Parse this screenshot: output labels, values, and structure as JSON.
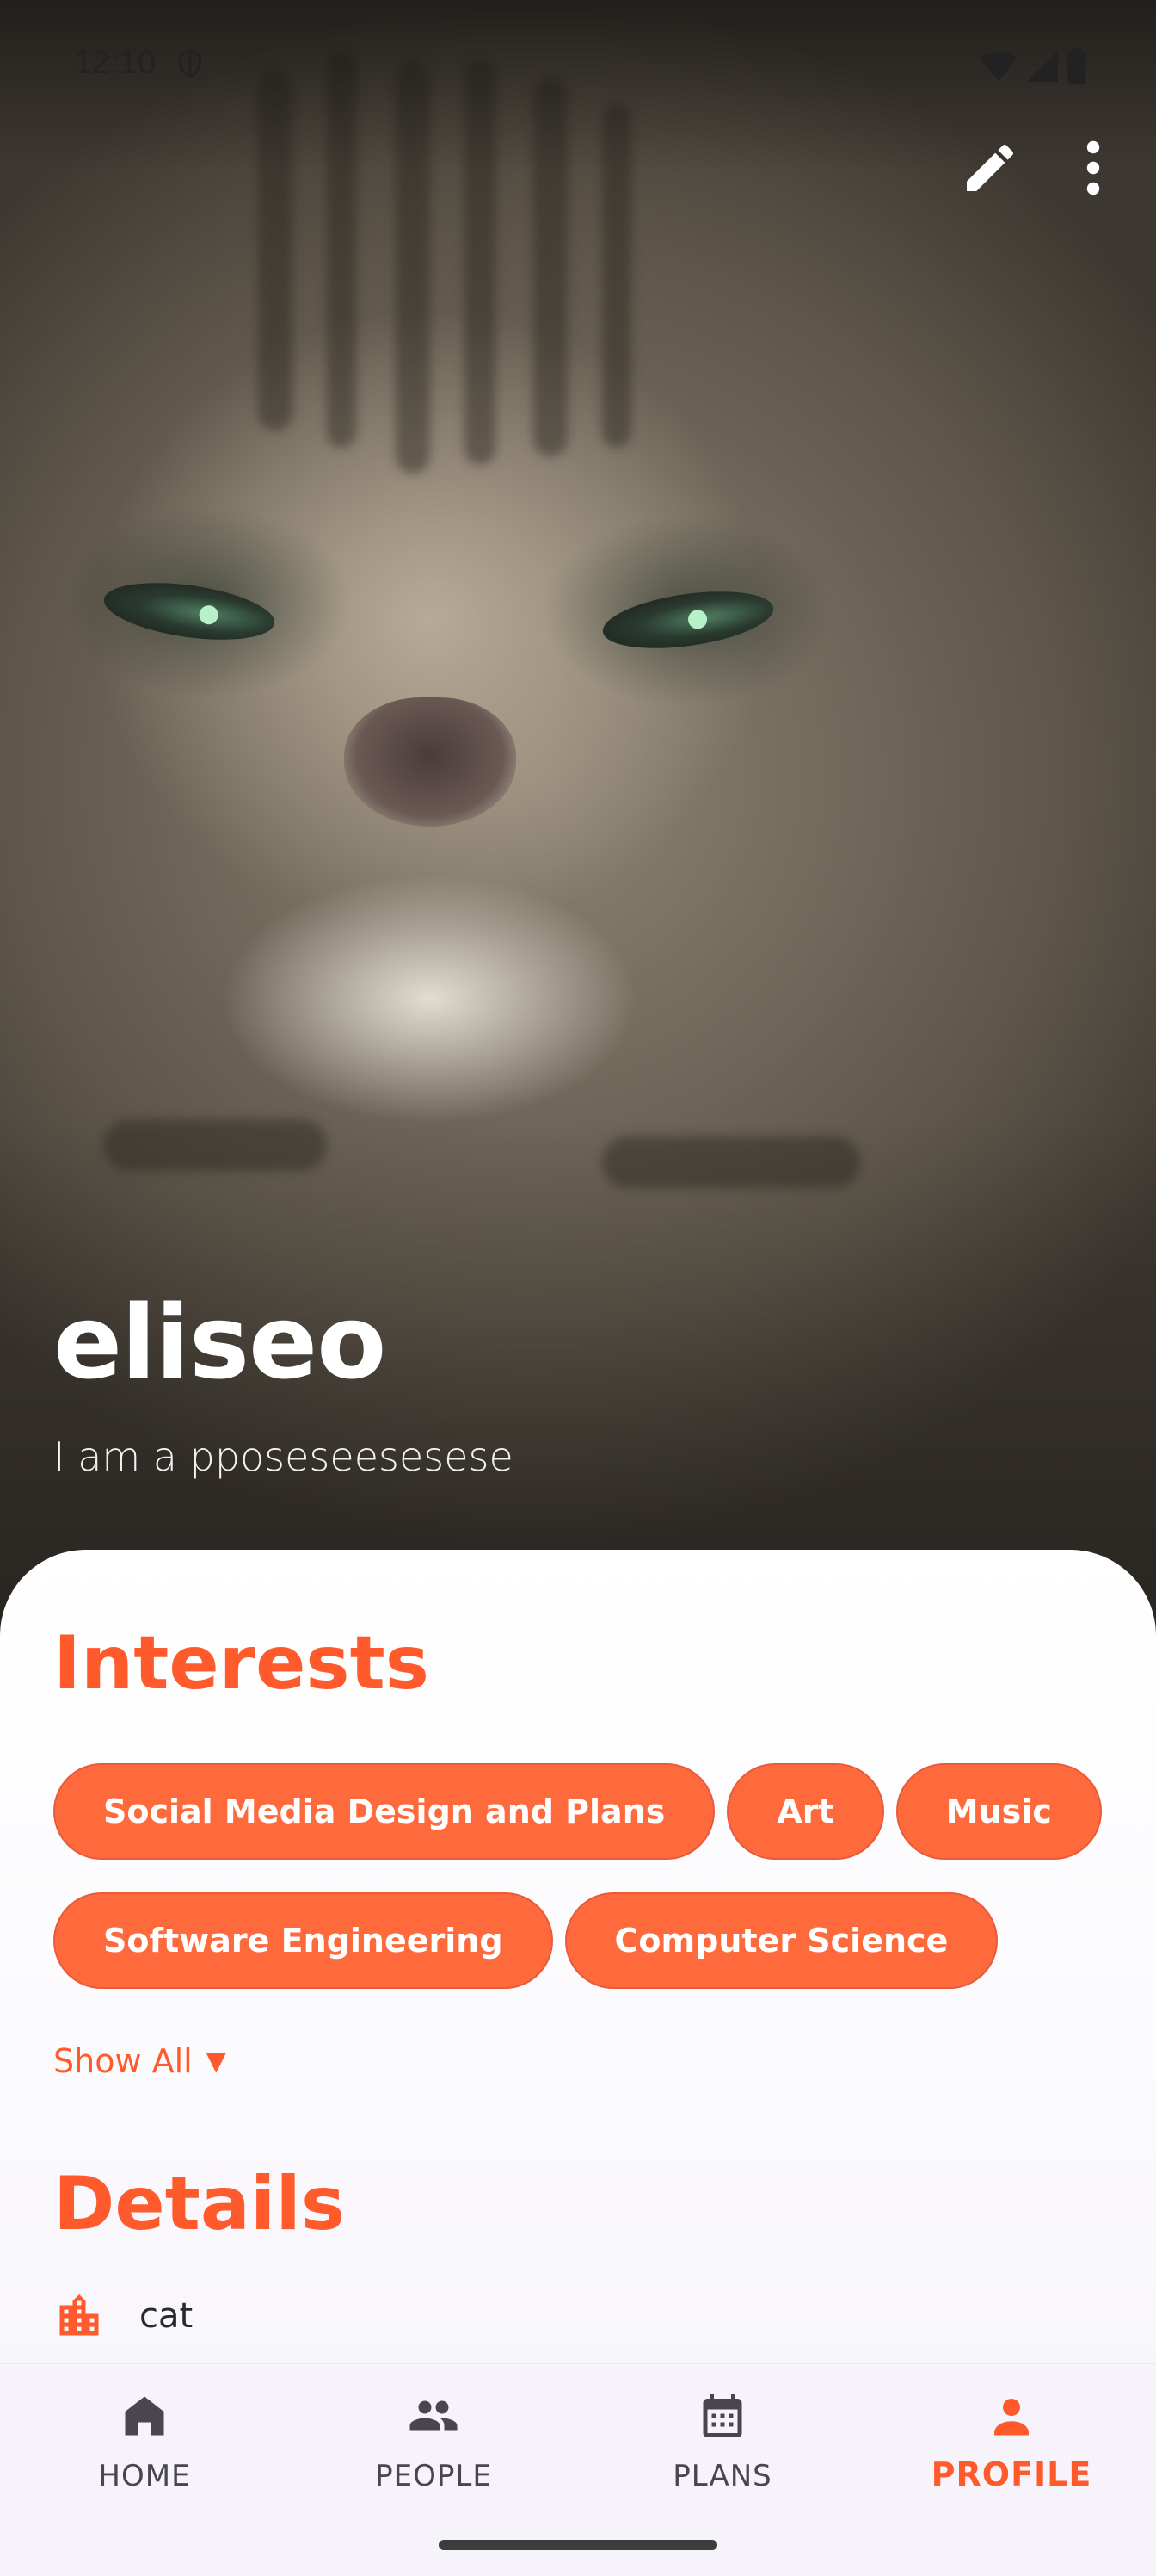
{
  "status_bar": {
    "time": "12:10"
  },
  "profile": {
    "name": "eliseo",
    "bio": "I am a pposeseesesese"
  },
  "interests": {
    "title": "Interests",
    "chips": [
      "Social Media Design and Plans",
      "Art",
      "Music",
      "Software Engineering",
      "Computer Science"
    ],
    "show_all": "Show All",
    "show_all_caret": "▼"
  },
  "details": {
    "title": "Details",
    "items": [
      {
        "icon": "building-icon",
        "text": "cat"
      }
    ]
  },
  "bottom_nav": {
    "items": [
      {
        "label": "HOME",
        "icon": "home-icon"
      },
      {
        "label": "PEOPLE",
        "icon": "people-icon"
      },
      {
        "label": "PLANS",
        "icon": "calendar-icon"
      },
      {
        "label": "PROFILE",
        "icon": "person-icon",
        "active": true
      }
    ]
  },
  "colors": {
    "accent": "#FF5A2C",
    "chip_fill": "#FF6A3D",
    "sheet_background": "#FBF9FD",
    "nav_inactive": "#4A4650"
  }
}
